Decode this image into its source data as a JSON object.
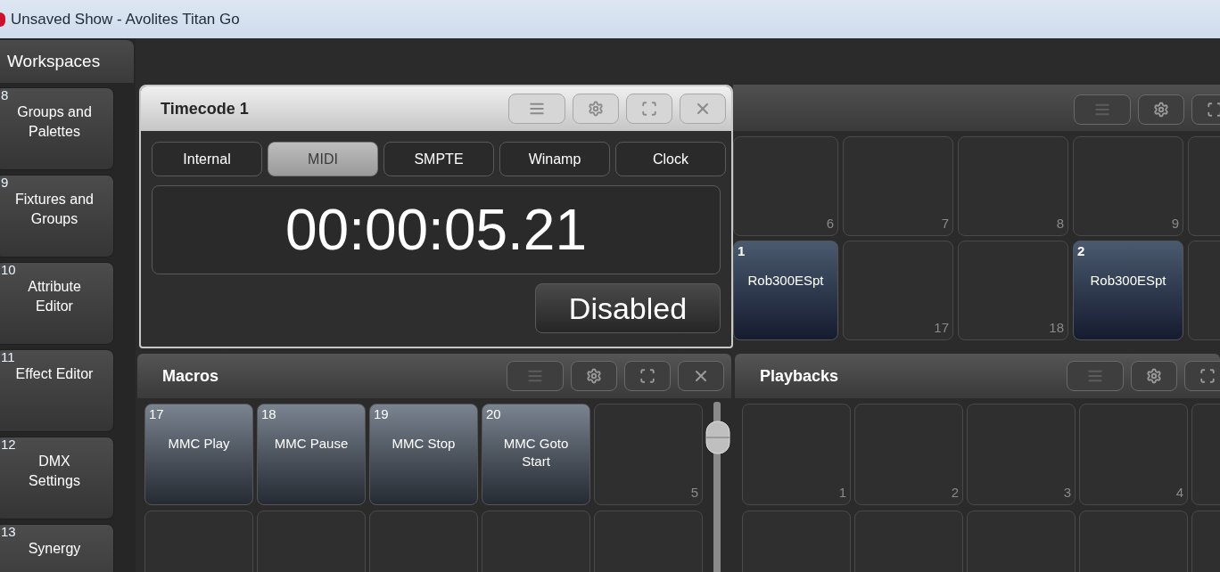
{
  "window": {
    "title": "Unsaved Show - Avolites Titan Go"
  },
  "sidebar": {
    "header": "Workspaces",
    "items": [
      {
        "number": "8",
        "label": "Groups and Palettes"
      },
      {
        "number": "9",
        "label": "Fixtures and Groups"
      },
      {
        "number": "10",
        "label": "Attribute Editor"
      },
      {
        "number": "11",
        "label": "Effect Editor"
      },
      {
        "number": "12",
        "label": "DMX Settings"
      },
      {
        "number": "13",
        "label": "Synergy"
      }
    ]
  },
  "timecode_window": {
    "title": "Timecode 1",
    "toolbar": [
      {
        "kind": "menu",
        "disabled": false
      },
      {
        "kind": "settings",
        "disabled": false
      },
      {
        "kind": "resize",
        "disabled": false
      },
      {
        "kind": "close",
        "disabled": false
      }
    ],
    "sources": [
      {
        "label": "Internal",
        "selected": false
      },
      {
        "label": "MIDI",
        "selected": true
      },
      {
        "label": "SMPTE",
        "selected": false
      },
      {
        "label": "Winamp",
        "selected": false
      },
      {
        "label": "Clock",
        "selected": false
      }
    ],
    "time": "00:00:05.21",
    "status_button": "Disabled"
  },
  "back_panel": {
    "toolbar": [
      {
        "kind": "menu",
        "disabled": true
      },
      {
        "kind": "settings",
        "disabled": false
      },
      {
        "kind": "resize",
        "disabled": false
      }
    ],
    "rows": [
      [
        {
          "kind": "empty",
          "number": "6"
        },
        {
          "kind": "empty",
          "number": "7"
        },
        {
          "kind": "empty",
          "number": "8"
        },
        {
          "kind": "empty",
          "number": "9"
        },
        {
          "kind": "empty"
        }
      ],
      [
        {
          "kind": "fixture",
          "number": "1",
          "label": "Rob300ESpt"
        },
        {
          "kind": "empty",
          "number": "17"
        },
        {
          "kind": "empty",
          "number": "18"
        },
        {
          "kind": "fixture",
          "number": "2",
          "label": "Rob300ESpt"
        },
        {
          "kind": "empty"
        }
      ]
    ]
  },
  "macros": {
    "title": "Macros",
    "toolbar": [
      {
        "kind": "menu",
        "disabled": true
      },
      {
        "kind": "settings",
        "disabled": false
      },
      {
        "kind": "resize",
        "disabled": false
      },
      {
        "kind": "close",
        "disabled": false
      }
    ],
    "rows": [
      [
        {
          "kind": "macro",
          "number": "17",
          "label": "MMC Play"
        },
        {
          "kind": "macro",
          "number": "18",
          "label": "MMC Pause"
        },
        {
          "kind": "macro",
          "number": "19",
          "label": "MMC Stop"
        },
        {
          "kind": "macro",
          "number": "20",
          "label": "MMC Goto Start"
        },
        {
          "kind": "empty",
          "number": "5"
        }
      ],
      [
        {
          "kind": "empty"
        },
        {
          "kind": "empty"
        },
        {
          "kind": "empty"
        },
        {
          "kind": "empty"
        },
        {
          "kind": "empty"
        }
      ]
    ]
  },
  "playbacks": {
    "title": "Playbacks",
    "toolbar": [
      {
        "kind": "menu",
        "disabled": true
      },
      {
        "kind": "settings",
        "disabled": false
      },
      {
        "kind": "resize",
        "disabled": false
      }
    ],
    "rows": [
      [
        {
          "kind": "empty",
          "number": "1"
        },
        {
          "kind": "empty",
          "number": "2"
        },
        {
          "kind": "empty",
          "number": "3"
        },
        {
          "kind": "empty",
          "number": "4"
        },
        {
          "kind": "empty"
        }
      ],
      [
        {
          "kind": "empty"
        },
        {
          "kind": "empty"
        },
        {
          "kind": "empty"
        },
        {
          "kind": "empty"
        },
        {
          "kind": "empty"
        }
      ]
    ]
  }
}
